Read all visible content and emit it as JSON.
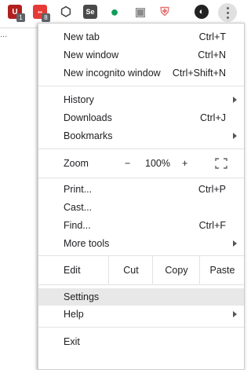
{
  "toolbar": {
    "extensions": [
      {
        "name": "ublock-origin-icon",
        "color": "#b21f1f",
        "glyph": "U",
        "badge": "1"
      },
      {
        "name": "extension-red-grid-icon",
        "color": "#e53935",
        "glyph": "▪▪",
        "badge": "8"
      },
      {
        "name": "openai-icon",
        "color": "#444444",
        "glyph": "⬡"
      },
      {
        "name": "selenium-icon",
        "color": "#4a4a4a",
        "glyph": "Se"
      },
      {
        "name": "hangouts-icon",
        "color": "#0f9d58",
        "glyph": "●"
      },
      {
        "name": "extension-window-icon",
        "color": "#8a8a8a",
        "glyph": "▣"
      },
      {
        "name": "shield-extension-icon",
        "color": "#e57373",
        "glyph": "⛨"
      },
      {
        "name": "profile-avatar",
        "color": "#222222",
        "glyph": "◐"
      }
    ],
    "page_dots": "..."
  },
  "menu": {
    "new_tab": {
      "label": "New tab",
      "shortcut": "Ctrl+T"
    },
    "new_window": {
      "label": "New window",
      "shortcut": "Ctrl+N"
    },
    "new_incognito": {
      "label": "New incognito window",
      "shortcut": "Ctrl+Shift+N"
    },
    "history": {
      "label": "History"
    },
    "downloads": {
      "label": "Downloads",
      "shortcut": "Ctrl+J"
    },
    "bookmarks": {
      "label": "Bookmarks"
    },
    "zoom": {
      "label": "Zoom",
      "minus": "−",
      "value": "100%",
      "plus": "+"
    },
    "print": {
      "label": "Print...",
      "shortcut": "Ctrl+P"
    },
    "cast": {
      "label": "Cast..."
    },
    "find": {
      "label": "Find...",
      "shortcut": "Ctrl+F"
    },
    "more_tools": {
      "label": "More tools"
    },
    "edit": {
      "label": "Edit",
      "cut": "Cut",
      "copy": "Copy",
      "paste": "Paste"
    },
    "settings": {
      "label": "Settings"
    },
    "help": {
      "label": "Help"
    },
    "exit": {
      "label": "Exit"
    }
  }
}
